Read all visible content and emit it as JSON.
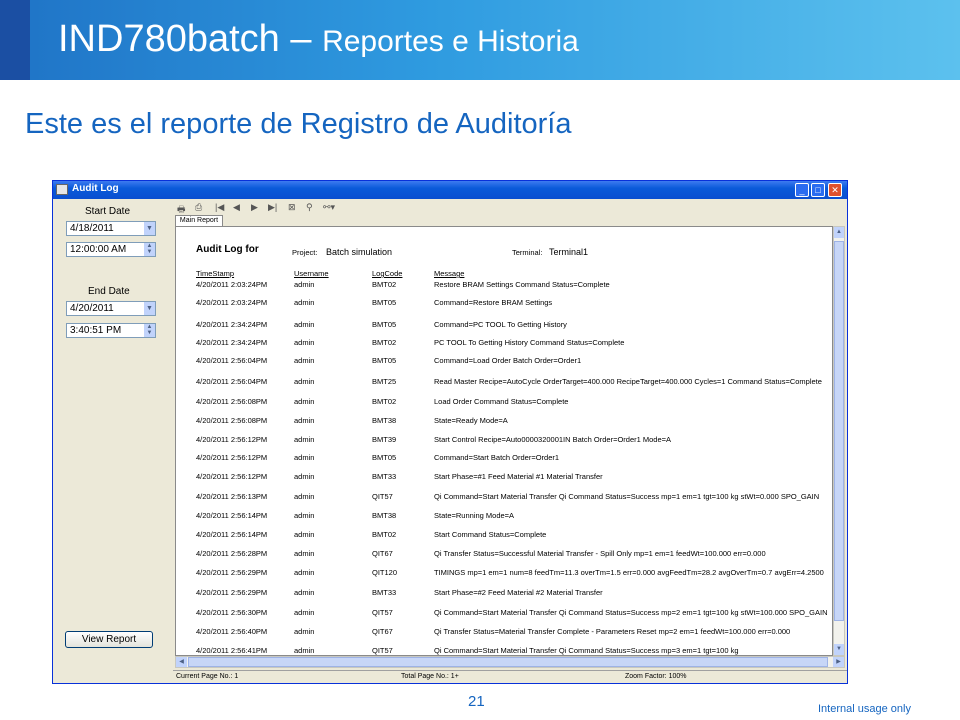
{
  "slide": {
    "title_main": "IND780batch – ",
    "title_sub": "Reportes e Historia",
    "subtitle": "Este es el reporte de Registro de Auditoría",
    "page_number": "21",
    "footer": "Internal usage only"
  },
  "window": {
    "title": "Audit Log",
    "min": "_",
    "max": "□",
    "close": "✕"
  },
  "filters": {
    "start_label": "Start Date",
    "start_date": "4/18/2011",
    "start_time": "12:00:00 AM",
    "end_label": "End Date",
    "end_date": "4/20/2011",
    "end_time": "3:40:51 PM",
    "view_button": "View Report"
  },
  "viewer": {
    "tab": "Main Report",
    "toolbar_icons": [
      "printer-icon",
      "export-icon",
      "first-page-icon",
      "prev-page-icon",
      "next-page-icon",
      "last-page-icon",
      "stop-icon",
      "search-icon",
      "zoom-icon"
    ],
    "status": {
      "current_page": "Current Page No.: 1",
      "total_page": "Total Page No.: 1+",
      "zoom": "Zoom Factor: 100%"
    }
  },
  "report": {
    "heading": "Audit Log for",
    "project_label": "Project:",
    "project_value": "Batch simulation",
    "terminal_label": "Terminal:",
    "terminal_value": "Terminal1",
    "columns": [
      "TimeStamp",
      "Username",
      "LogCode",
      "Message"
    ],
    "rows": [
      {
        "time": "4/20/2011   2:03:24PM",
        "user": "admin",
        "code": "BMT02",
        "msg": "Restore BRAM Settings Command Status=Complete"
      },
      {
        "time": "4/20/2011   2:03:24PM",
        "user": "admin",
        "code": "BMT05",
        "msg": "Command=Restore BRAM Settings"
      },
      {
        "time": "4/20/2011   2:34:24PM",
        "user": "admin",
        "code": "BMT05",
        "msg": "Command=PC TOOL To Getting History"
      },
      {
        "time": "4/20/2011   2:34:24PM",
        "user": "admin",
        "code": "BMT02",
        "msg": "PC TOOL To Getting History Command Status=Complete"
      },
      {
        "time": "4/20/2011   2:56:04PM",
        "user": "admin",
        "code": "BMT05",
        "msg": "Command=Load Order Batch Order=Order1"
      },
      {
        "time": "4/20/2011   2:56:04PM",
        "user": "admin",
        "code": "BMT25",
        "msg": "Read Master Recipe=AutoCycle OrderTarget=400.000 RecipeTarget=400.000 Cycles=1 Command Status=Complete"
      },
      {
        "time": "4/20/2011   2:56:08PM",
        "user": "admin",
        "code": "BMT02",
        "msg": "Load Order Command Status=Complete"
      },
      {
        "time": "4/20/2011   2:56:08PM",
        "user": "admin",
        "code": "BMT38",
        "msg": "State=Ready Mode=A"
      },
      {
        "time": "4/20/2011   2:56:12PM",
        "user": "admin",
        "code": "BMT39",
        "msg": "Start Control Recipe=Auto0000320001IN Batch Order=Order1 Mode=A"
      },
      {
        "time": "4/20/2011   2:56:12PM",
        "user": "admin",
        "code": "BMT05",
        "msg": "Command=Start Batch Order=Order1"
      },
      {
        "time": "4/20/2011   2:56:12PM",
        "user": "admin",
        "code": "BMT33",
        "msg": "Start Phase=#1 Feed Material #1 Material Transfer"
      },
      {
        "time": "4/20/2011   2:56:13PM",
        "user": "admin",
        "code": "QIT57",
        "msg": "Qi Command=Start Material Transfer Qi Command Status=Success mp=1 em=1 tgt=100 kg stWt=0.000 SPO_GAIN"
      },
      {
        "time": "4/20/2011   2:56:14PM",
        "user": "admin",
        "code": "BMT38",
        "msg": "State=Running Mode=A"
      },
      {
        "time": "4/20/2011   2:56:14PM",
        "user": "admin",
        "code": "BMT02",
        "msg": "Start Command Status=Complete"
      },
      {
        "time": "4/20/2011   2:56:28PM",
        "user": "admin",
        "code": "QIT67",
        "msg": "Qi Transfer Status=Successful Material Transfer - Spill Only mp=1 em=1 feedWt=100.000 err=0.000"
      },
      {
        "time": "4/20/2011   2:56:29PM",
        "user": "admin",
        "code": "QIT120",
        "msg": "TIMINGS mp=1 em=1 num=8 feedTm=11.3 overTm=1.5 err=0.000 avgFeedTm=28.2 avgOverTm=0.7 avgErr=4.2500"
      },
      {
        "time": "4/20/2011   2:56:29PM",
        "user": "admin",
        "code": "BMT33",
        "msg": "Start Phase=#2 Feed Material #2 Material Transfer"
      },
      {
        "time": "4/20/2011   2:56:30PM",
        "user": "admin",
        "code": "QIT57",
        "msg": "Qi Command=Start Material Transfer Qi Command Status=Success mp=2 em=1 tgt=100 kg stWt=100.000 SPO_GAIN"
      },
      {
        "time": "4/20/2011   2:56:40PM",
        "user": "admin",
        "code": "QIT67",
        "msg": "Qi Transfer Status=Material Transfer Complete - Parameters Reset mp=2 em=1 feedWt=100.000 err=0.000"
      },
      {
        "time": "4/20/2011   2:56:41PM",
        "user": "admin",
        "code": "QIT57",
        "msg": "Qi Command=Start Material Transfer Qi Command Status=Success mp=3 em=1 tgt=100 kg"
      }
    ]
  }
}
